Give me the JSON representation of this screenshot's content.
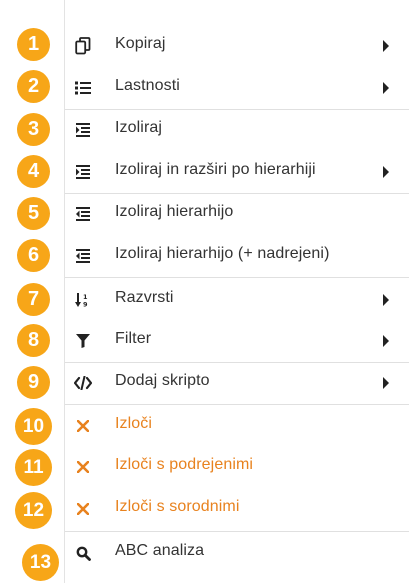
{
  "menu": {
    "items": [
      {
        "label": "Kopiraj",
        "icon": "copy-icon",
        "submenu": true,
        "badge": "1"
      },
      {
        "label": "Lastnosti",
        "icon": "list-icon",
        "submenu": true,
        "badge": "2"
      },
      {
        "label": "Izoliraj",
        "icon": "isolate-icon",
        "submenu": false,
        "badge": "3"
      },
      {
        "label": "Izoliraj in razširi po hierarhiji",
        "icon": "isolate-expand-icon",
        "submenu": true,
        "badge": "4"
      },
      {
        "label": "Izoliraj hierarhijo",
        "icon": "hierarchy-icon",
        "submenu": false,
        "badge": "5"
      },
      {
        "label": "Izoliraj hierarhijo (+ nadrejeni)",
        "icon": "hierarchy-parent-icon",
        "submenu": false,
        "badge": "6"
      },
      {
        "label": "Razvrsti",
        "icon": "sort-icon",
        "submenu": true,
        "badge": "7"
      },
      {
        "label": "Filter",
        "icon": "filter-icon",
        "submenu": true,
        "badge": "8"
      },
      {
        "label": "Dodaj skripto",
        "icon": "code-icon",
        "submenu": true,
        "badge": "9"
      },
      {
        "label": "Izloči",
        "icon": "close-icon",
        "submenu": false,
        "badge": "10"
      },
      {
        "label": "Izloči s podrejenimi",
        "icon": "close-icon",
        "submenu": false,
        "badge": "11"
      },
      {
        "label": "Izloči s sorodnimi",
        "icon": "close-icon",
        "submenu": false,
        "badge": "12"
      },
      {
        "label": "ABC analiza",
        "icon": "search-icon",
        "submenu": false,
        "badge": "13"
      }
    ]
  },
  "colors": {
    "badge": "#f7a618",
    "danger": "#e8821e",
    "text": "#333333"
  }
}
